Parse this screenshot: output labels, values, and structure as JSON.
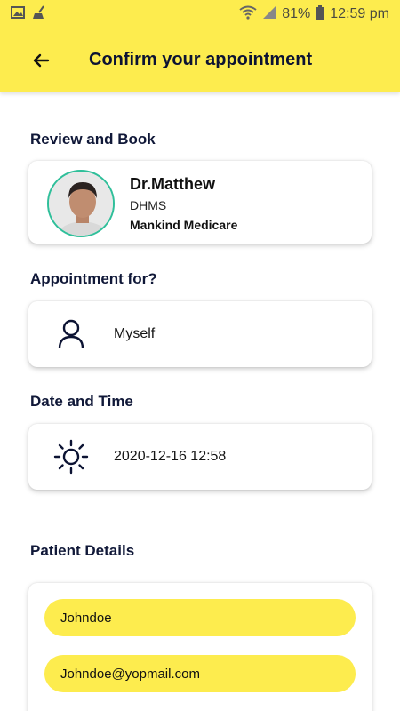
{
  "status_bar": {
    "battery": "81%",
    "time": "12:59 pm"
  },
  "app_bar": {
    "title": "Confirm your appointment"
  },
  "review_section": {
    "title": "Review and Book",
    "doctor": {
      "name": "Dr.Matthew",
      "degree": "DHMS",
      "organization": "Mankind Medicare"
    }
  },
  "appointment_for": {
    "title": "Appointment for?",
    "value": "Myself",
    "icon": "person-icon"
  },
  "date_time": {
    "title": "Date and Time",
    "value": "2020-12-16 12:58",
    "icon": "sun-icon"
  },
  "patient_details": {
    "title": "Patient Details",
    "name_value": "Johndoe",
    "email_value": "Johndoe@yopmail.com"
  },
  "colors": {
    "accent": "#fdec4e",
    "avatar_border": "#2fbf9a",
    "title_text": "#0c1333"
  }
}
